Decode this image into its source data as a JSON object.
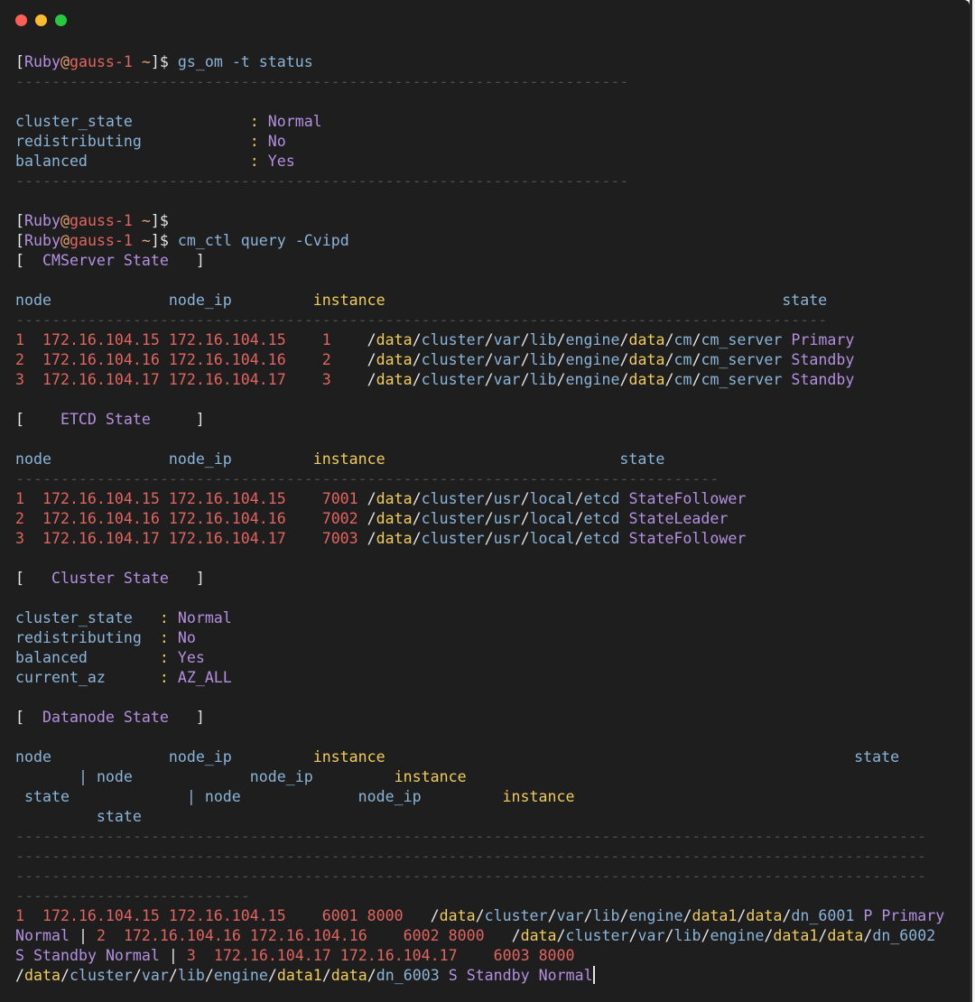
{
  "window": {
    "buttons": {
      "close_color": "#ff5f57",
      "minimize_color": "#febc2e",
      "maximize_color": "#28c840"
    }
  },
  "prompt": {
    "open": "[",
    "user": "Ruby",
    "at": "@",
    "host": "gauss-1",
    "path": " ~",
    "close": "]$"
  },
  "commands": {
    "status": "gs_om -t status",
    "query": "cm_ctl query -Cvipd"
  },
  "rules": {
    "short": "--------------------------------------------------------------------",
    "medium": "-------------------------------------------------------------------------------",
    "cm": "------------------------------------------------------------------------------------------",
    "etcd": "------------------------------------------------------------------------------",
    "long": "-----------------------------------------------------------------------------------------------------",
    "tail": "--------------------------"
  },
  "status": {
    "rows": [
      {
        "key": "cluster_state             ",
        "colon": ": ",
        "value": "Normal"
      },
      {
        "key": "redistributing            ",
        "colon": ": ",
        "value": "No"
      },
      {
        "key": "balanced                  ",
        "colon": ": ",
        "value": "Yes"
      }
    ]
  },
  "cmserver": {
    "title_open": "[  ",
    "title": "CMServer State",
    "title_close": "   ]",
    "headers": {
      "node": "node",
      "node_ip": "node_ip",
      "instance": "instance",
      "state": "state"
    },
    "rows": [
      {
        "node": "1",
        "host": "172.16.104.15",
        "ip": "172.16.104.15",
        "instance": "1",
        "path": [
          "/data",
          "/cluster",
          "/var",
          "/lib",
          "/engine",
          "/data",
          "/cm",
          "/cm_server"
        ],
        "state": "Primary"
      },
      {
        "node": "2",
        "host": "172.16.104.16",
        "ip": "172.16.104.16",
        "instance": "2",
        "path": [
          "/data",
          "/cluster",
          "/var",
          "/lib",
          "/engine",
          "/data",
          "/cm",
          "/cm_server"
        ],
        "state": "Standby"
      },
      {
        "node": "3",
        "host": "172.16.104.17",
        "ip": "172.16.104.17",
        "instance": "3",
        "path": [
          "/data",
          "/cluster",
          "/var",
          "/lib",
          "/engine",
          "/data",
          "/cm",
          "/cm_server"
        ],
        "state": "Standby"
      }
    ]
  },
  "etcd": {
    "title_open": "[    ",
    "title": "ETCD State",
    "title_close": "     ]",
    "headers": {
      "node": "node",
      "node_ip": "node_ip",
      "instance": "instance",
      "state": "state"
    },
    "rows": [
      {
        "node": "1",
        "host": "172.16.104.15",
        "ip": "172.16.104.15",
        "instance": "7001",
        "path": [
          "/data",
          "/cluster",
          "/usr",
          "/local",
          "/etcd"
        ],
        "state": "StateFollower"
      },
      {
        "node": "2",
        "host": "172.16.104.16",
        "ip": "172.16.104.16",
        "instance": "7002",
        "path": [
          "/data",
          "/cluster",
          "/usr",
          "/local",
          "/etcd"
        ],
        "state": "StateLeader"
      },
      {
        "node": "3",
        "host": "172.16.104.17",
        "ip": "172.16.104.17",
        "instance": "7003",
        "path": [
          "/data",
          "/cluster",
          "/usr",
          "/local",
          "/etcd"
        ],
        "state": "StateFollower"
      }
    ]
  },
  "cluster": {
    "title_open": "[   ",
    "title": "Cluster State",
    "title_close": "   ]",
    "rows": [
      {
        "key": "cluster_state   ",
        "colon": ": ",
        "value": "Normal"
      },
      {
        "key": "redistributing  ",
        "colon": ": ",
        "value": "No"
      },
      {
        "key": "balanced        ",
        "colon": ": ",
        "value": "Yes"
      },
      {
        "key": "current_az      ",
        "colon": ": ",
        "value": "AZ_ALL"
      }
    ]
  },
  "datanode": {
    "title_open": "[  ",
    "title": "Datanode State",
    "title_close": "   ]",
    "headers": {
      "node": "node",
      "node_ip": "node_ip",
      "instance": "instance",
      "state": "state",
      "separator": "|"
    },
    "rows": [
      {
        "node": "1",
        "host": "172.16.104.15",
        "ip": "172.16.104.15",
        "instance": "6001",
        "port": "8000",
        "path": [
          "/data",
          "/cluster",
          "/var",
          "/lib",
          "/engine",
          "/data1",
          "/data",
          "/dn_6001"
        ],
        "role": "P",
        "state": "Primary",
        "db_state": "Normal"
      },
      {
        "node": "2",
        "host": "172.16.104.16",
        "ip": "172.16.104.16",
        "instance": "6002",
        "port": "8000",
        "path": [
          "/data",
          "/cluster",
          "/var",
          "/lib",
          "/engine",
          "/data1",
          "/data",
          "/dn_6002"
        ],
        "role": "S",
        "state": "Standby",
        "db_state": "Normal"
      },
      {
        "node": "3",
        "host": "172.16.104.17",
        "ip": "172.16.104.17",
        "instance": "6003",
        "port": "8000",
        "path": [
          "/data",
          "/cluster",
          "/var",
          "/lib",
          "/engine",
          "/data1",
          "/data",
          "/dn_6003"
        ],
        "role": "S",
        "state": "Standby",
        "db_state": "Normal"
      }
    ]
  }
}
